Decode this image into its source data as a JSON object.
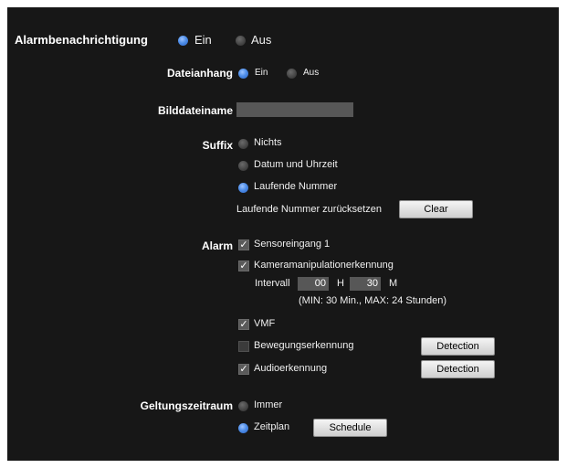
{
  "alarm_notification": {
    "label": "Alarmbenachrichtigung",
    "on": "Ein",
    "off": "Aus",
    "selected": "on"
  },
  "attachment": {
    "label": "Dateianhang",
    "on": "Ein",
    "off": "Aus",
    "selected": "on"
  },
  "image_filename": {
    "label": "Bilddateiname",
    "value": ""
  },
  "suffix": {
    "label": "Suffix",
    "options": [
      "Nichts",
      "Datum und Uhrzeit",
      "Laufende Nummer"
    ],
    "selected_index": 2,
    "reset_label": "Laufende Nummer zurücksetzen",
    "clear_button": "Clear"
  },
  "alarm": {
    "label": "Alarm",
    "sensor_input": {
      "label": "Sensoreingang 1",
      "checked": true
    },
    "camera_tamper": {
      "label": "Kameramanipulationerkennung",
      "checked": true
    },
    "interval": {
      "label": "Intervall",
      "hours": "00",
      "hours_unit": "H",
      "minutes": "30",
      "minutes_unit": "M",
      "note": "(MIN: 30 Min., MAX: 24 Stunden)"
    },
    "vmf": {
      "label": "VMF",
      "checked": true
    },
    "motion_detection": {
      "label": "Bewegungserkennung",
      "checked": false,
      "button": "Detection"
    },
    "audio_detection": {
      "label": "Audioerkennung",
      "checked": true,
      "button": "Detection"
    }
  },
  "validity": {
    "label": "Geltungszeitraum",
    "always": "Immer",
    "schedule": "Zeitplan",
    "schedule_button": "Schedule",
    "selected": "schedule"
  },
  "colors": {
    "panel_bg": "#171717",
    "radio_selected": "#4f8ee8",
    "field_bg": "#575757"
  }
}
